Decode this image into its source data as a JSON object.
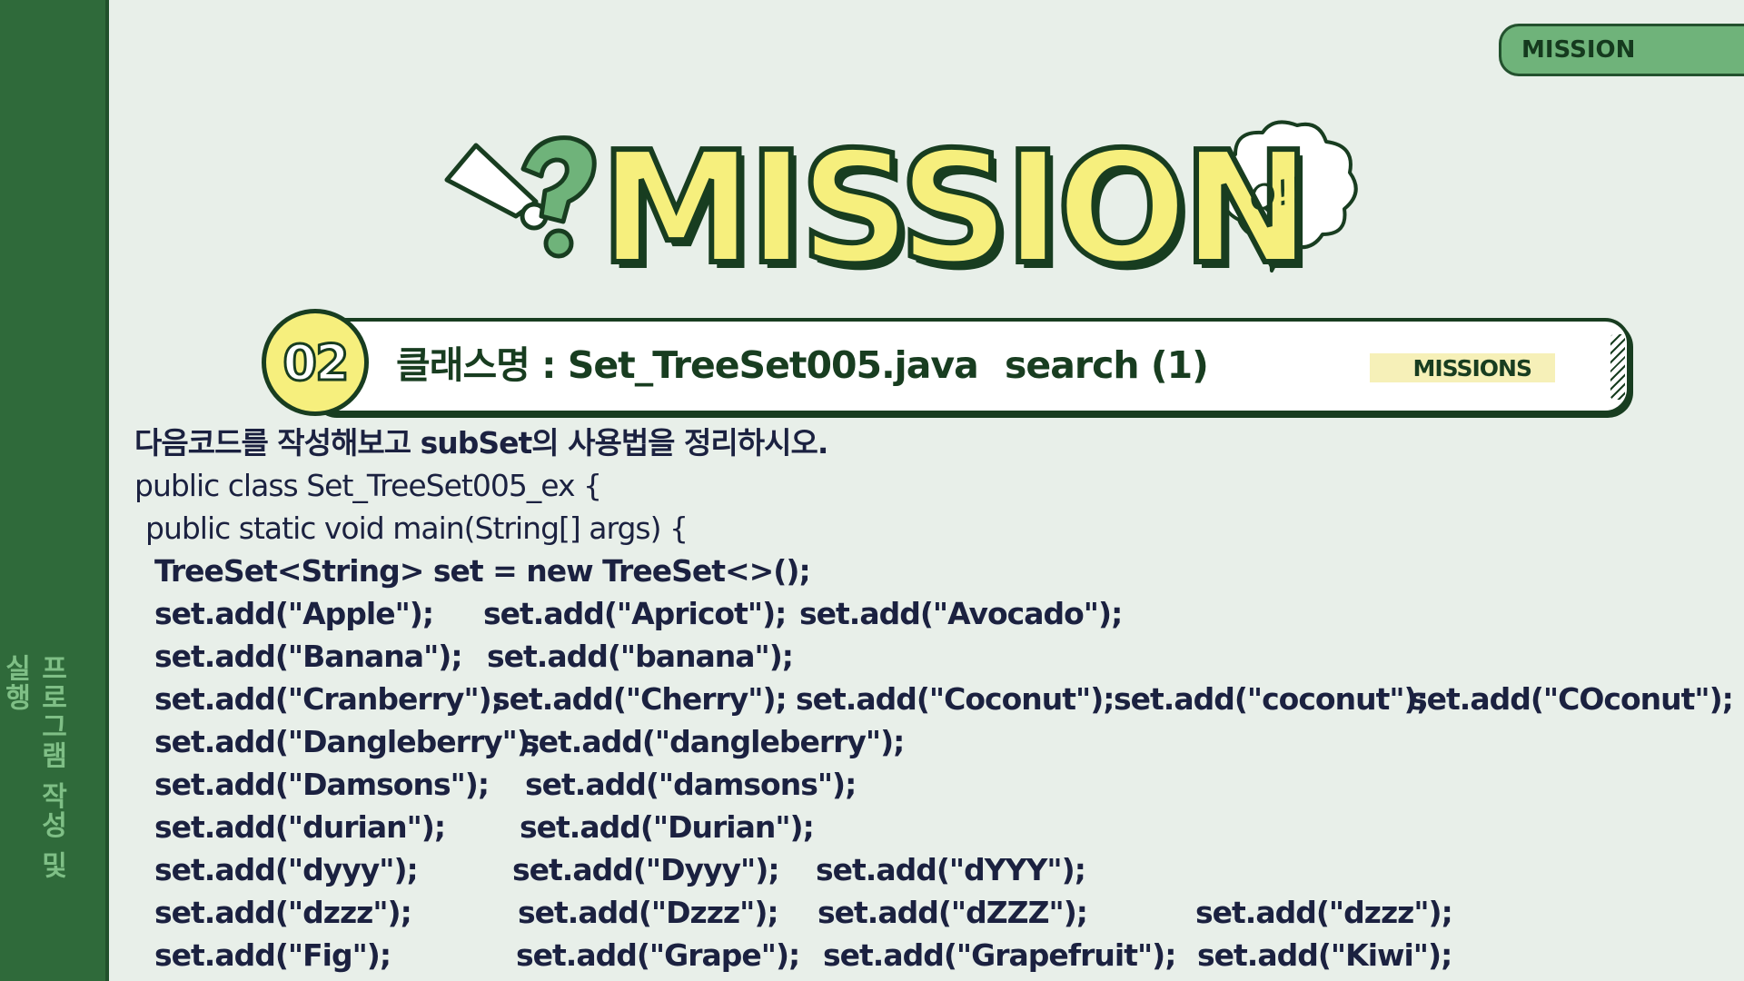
{
  "sidebar": {
    "label": "프로그램 작성 및 실행"
  },
  "tab": {
    "label": "MISSION"
  },
  "title": {
    "text": "MISSION",
    "bubble": "Q!!"
  },
  "banner": {
    "number": "02",
    "class_label": "클래스명 : Set_TreeSet005.java",
    "search_label": "search (1)",
    "missions_tag": "MISSIONS"
  },
  "content": {
    "instruction": "다음코드를 작성해보고 subSet의 사용법을 정리하시오.",
    "code_lines": [
      "public class Set_TreeSet005_ex {",
      "public static void main(String[] args) {",
      "TreeSet<String> set = new TreeSet<>();"
    ],
    "add_rows": [
      [
        "set.add(\"Apple\");",
        "set.add(\"Apricot\");",
        "set.add(\"Avocado\");"
      ],
      [
        "set.add(\"Banana\");",
        "set.add(\"banana\");"
      ],
      [
        "set.add(\"Cranberry\");",
        "set.add(\"Cherry\");",
        "set.add(\"Coconut\");",
        "set.add(\"coconut\");",
        "set.add(\"COconut\");"
      ],
      [
        "set.add(\"Dangleberry\");",
        "set.add(\"dangleberry\");"
      ],
      [
        "set.add(\"Damsons\");",
        "set.add(\"damsons\");"
      ],
      [
        "set.add(\"durian\");",
        "set.add(\"Durian\");"
      ],
      [
        "set.add(\"dyyy\");",
        "set.add(\"Dyyy\");",
        "set.add(\"dYYY\");"
      ],
      [
        "set.add(\"dzzz\");",
        "set.add(\"Dzzz\");",
        "set.add(\"dZZZ\");",
        "set.add(\"dzzz\");"
      ],
      [
        "set.add(\"Fig\");",
        "set.add(\"Grape\");",
        "set.add(\"Grapefruit\");",
        "set.add(\"Kiwi\");"
      ]
    ]
  },
  "colors": {
    "background": "#e8efe9",
    "sidebar": "#2f6a3a",
    "accent_green": "#6fb37a",
    "title_yellow": "#f6ef7d",
    "dark_outline": "#183d20",
    "code_text": "#1b2140"
  },
  "icons": [
    "exclamation-icon",
    "question-mark-icon",
    "speech-bubble-icon"
  ]
}
